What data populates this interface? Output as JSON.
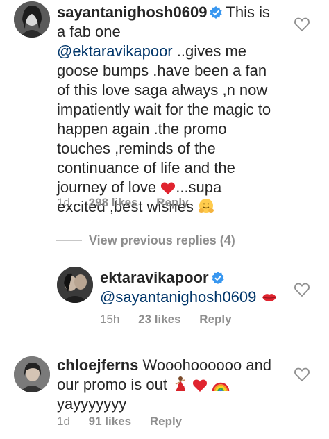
{
  "comments": [
    {
      "username": "sayantanighosh0609",
      "verified": true,
      "text_parts": {
        "lead": "This is",
        "line2_pre": "a fab one",
        "mention": "@ektaravikapoor",
        "line3_rest": "..gives me",
        "line4": "goose bumps .have been a fan",
        "line5": "of this love saga always ,n now",
        "line6": "impatiently wait for the magic to",
        "line7": "happen again .the promo",
        "line8": "touches ,reminds of the",
        "line9": "continuance of life and the",
        "line10_pre": "journey of love",
        "line10_post": "...supa",
        "line11": "excited ,best wishes"
      },
      "time": "1d",
      "likes": "298 likes",
      "reply": "Reply"
    },
    {
      "username": "ektaravikapoor",
      "verified": true,
      "mention": "@sayantanighosh0609",
      "time": "15h",
      "likes": "23 likes",
      "reply": "Reply"
    },
    {
      "username": "chloejferns",
      "verified": false,
      "line1": "Wooohoooooo and",
      "line2": "our promo is out",
      "line3": "yayyyyyyy",
      "time": "1d",
      "likes": "91 likes",
      "reply": "Reply"
    }
  ],
  "view_previous": "View previous replies (4)",
  "colors": {
    "text": "#262626",
    "muted": "#8e8e8e",
    "mention": "#003569",
    "verified": "#3897f0",
    "heart_emoji": "#e0242f"
  },
  "icons": [
    "verified-badge-icon",
    "heart-outline-icon",
    "red-heart-emoji",
    "hugging-face-emoji",
    "kiss-mark-emoji",
    "dancer-emoji",
    "rainbow-emoji"
  ]
}
